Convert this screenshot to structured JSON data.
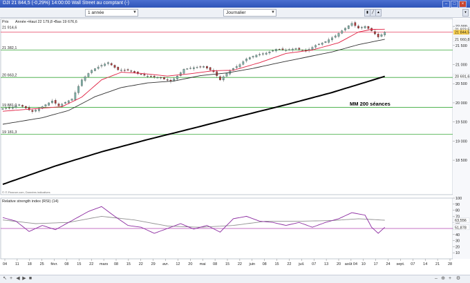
{
  "window": {
    "title": "DJI 21 844,5 (-0,29%) 14:00:00 Wall Street au comptant (-)",
    "logo_icon": "dji-instrument-icon"
  },
  "toolbar": {
    "period": "1 année",
    "interval": "Journalier"
  },
  "colors": {
    "candle_up": "#7fb2a8",
    "candle_down": "#b03a3a",
    "ma20": "#e01e40",
    "ma50": "#303030",
    "ma200": "#000000",
    "levels": "#38a838",
    "current": "#e01e40",
    "rsi": "#8b2aa0",
    "rsi_signal": "#909090",
    "rsi_mid": "#b040b0"
  },
  "chart_data": [
    {
      "type": "candlestick",
      "panel": "price",
      "title": "Prix",
      "info": "Année •Haut 22 179,8 •Bas 19 676,6",
      "source": "© IT-Finance.com, Données indicatives",
      "annotation": "MM 200 séances",
      "ylim": [
        17600,
        22200
      ],
      "y_ticks": [
        "22 000",
        "21 500",
        "21 000",
        "20 500",
        "20 000",
        "19 500",
        "19 000",
        "18 500"
      ],
      "y_tick_values": [
        22000,
        21500,
        21000,
        20500,
        20000,
        19500,
        19000,
        18500
      ],
      "horizontal_levels": [
        {
          "label": "21 382,1",
          "value": 21382.1
        },
        {
          "label": "20 663,2",
          "value": 20663.2
        },
        {
          "label": "19 881,0",
          "value": 19881
        },
        {
          "label": "19 181,3",
          "value": 19181.3
        }
      ],
      "value_tags": [
        {
          "label": "21 923,5",
          "value": 21923.5
        },
        {
          "label": "21 844,5",
          "value": 21844.5
        },
        {
          "label": "21 660,8",
          "value": 21660.8
        },
        {
          "label": "20 691,6",
          "value": 20691.6
        }
      ],
      "left_labels": [
        {
          "label": "21 914,6",
          "value": 21914.6
        }
      ],
      "current_price": {
        "label": "21 844,5",
        "value": 21844.5
      },
      "x_ticks": [
        "04",
        "11",
        "18",
        "25",
        "févr.",
        "08",
        "15",
        "22",
        "mars",
        "08",
        "15",
        "22",
        "29",
        "avr.",
        "12",
        "20",
        "mai",
        "08",
        "15",
        "22",
        "juin",
        "08",
        "15",
        "22",
        "juil.",
        "07",
        "13",
        "20",
        "août 04",
        "10",
        "17",
        "24",
        "sept.",
        "07",
        "14",
        "21",
        "28"
      ],
      "anchors": [
        {
          "d": 0,
          "c": 19850
        },
        {
          "d": 3,
          "c": 19880
        },
        {
          "d": 5,
          "c": 19950
        },
        {
          "d": 9,
          "c": 19770
        },
        {
          "d": 12,
          "c": 19900
        },
        {
          "d": 15,
          "c": 20050
        },
        {
          "d": 17,
          "c": 19920
        },
        {
          "d": 21,
          "c": 20100
        },
        {
          "d": 24,
          "c": 20600
        },
        {
          "d": 27,
          "c": 20850
        },
        {
          "d": 30,
          "c": 20980
        },
        {
          "d": 32,
          "c": 21050
        },
        {
          "d": 35,
          "c": 20860
        },
        {
          "d": 38,
          "c": 20850
        },
        {
          "d": 41,
          "c": 20760
        },
        {
          "d": 44,
          "c": 20700
        },
        {
          "d": 48,
          "c": 20650
        },
        {
          "d": 51,
          "c": 20560
        },
        {
          "d": 53,
          "c": 20700
        },
        {
          "d": 55,
          "c": 20880
        },
        {
          "d": 58,
          "c": 20920
        },
        {
          "d": 61,
          "c": 20950
        },
        {
          "d": 64,
          "c": 20810
        },
        {
          "d": 66,
          "c": 20600
        },
        {
          "d": 69,
          "c": 20850
        },
        {
          "d": 72,
          "c": 21000
        },
        {
          "d": 74,
          "c": 21150
        },
        {
          "d": 77,
          "c": 21250
        },
        {
          "d": 80,
          "c": 21300
        },
        {
          "d": 83,
          "c": 21400
        },
        {
          "d": 86,
          "c": 21380
        },
        {
          "d": 89,
          "c": 21420
        },
        {
          "d": 92,
          "c": 21350
        },
        {
          "d": 95,
          "c": 21500
        },
        {
          "d": 98,
          "c": 21600
        },
        {
          "d": 101,
          "c": 21750
        },
        {
          "d": 104,
          "c": 21950
        },
        {
          "d": 106,
          "c": 22080
        },
        {
          "d": 108,
          "c": 21950
        },
        {
          "d": 110,
          "c": 22000
        },
        {
          "d": 112,
          "c": 21880
        },
        {
          "d": 114,
          "c": 21720
        },
        {
          "d": 116,
          "c": 21844.5
        }
      ],
      "ma20_anchors": [
        {
          "d": 0,
          "v": 19780
        },
        {
          "d": 18,
          "v": 19900
        },
        {
          "d": 24,
          "v": 20150
        },
        {
          "d": 30,
          "v": 20600
        },
        {
          "d": 36,
          "v": 20800
        },
        {
          "d": 42,
          "v": 20770
        },
        {
          "d": 50,
          "v": 20700
        },
        {
          "d": 57,
          "v": 20760
        },
        {
          "d": 64,
          "v": 20840
        },
        {
          "d": 70,
          "v": 20850
        },
        {
          "d": 78,
          "v": 21050
        },
        {
          "d": 86,
          "v": 21290
        },
        {
          "d": 94,
          "v": 21380
        },
        {
          "d": 102,
          "v": 21570
        },
        {
          "d": 108,
          "v": 21850
        },
        {
          "d": 112,
          "v": 21920
        },
        {
          "d": 116,
          "v": 21923.5
        }
      ],
      "ma50_anchors": [
        {
          "d": 0,
          "v": 19440
        },
        {
          "d": 12,
          "v": 19610
        },
        {
          "d": 20,
          "v": 19800
        },
        {
          "d": 28,
          "v": 20160
        },
        {
          "d": 36,
          "v": 20400
        },
        {
          "d": 44,
          "v": 20520
        },
        {
          "d": 52,
          "v": 20570
        },
        {
          "d": 60,
          "v": 20710
        },
        {
          "d": 68,
          "v": 20780
        },
        {
          "d": 76,
          "v": 20900
        },
        {
          "d": 84,
          "v": 21050
        },
        {
          "d": 92,
          "v": 21190
        },
        {
          "d": 100,
          "v": 21330
        },
        {
          "d": 108,
          "v": 21520
        },
        {
          "d": 116,
          "v": 21660.8
        }
      ],
      "ma200_anchors": [
        {
          "d": 0,
          "v": 17870
        },
        {
          "d": 16,
          "v": 18350
        },
        {
          "d": 30,
          "v": 18720
        },
        {
          "d": 44,
          "v": 19040
        },
        {
          "d": 58,
          "v": 19340
        },
        {
          "d": 72,
          "v": 19650
        },
        {
          "d": 86,
          "v": 19950
        },
        {
          "d": 100,
          "v": 20270
        },
        {
          "d": 116,
          "v": 20691.6
        }
      ]
    },
    {
      "type": "line",
      "panel": "rsi",
      "title": "Relative strength index (RSI) (14)",
      "ylim": [
        0,
        100
      ],
      "y_ticks": [
        "100",
        "90",
        "80",
        "70",
        "60",
        "50",
        "40",
        "30",
        "20",
        "10"
      ],
      "y_tick_values": [
        100,
        90,
        80,
        70,
        60,
        50,
        40,
        30,
        20,
        10
      ],
      "value_tags": [
        {
          "label": "63,556",
          "value": 63.556
        },
        {
          "label": "51,878",
          "value": 51.878
        }
      ],
      "midline": 50,
      "rsi_anchors": [
        {
          "d": 0,
          "v": 68
        },
        {
          "d": 4,
          "v": 62
        },
        {
          "d": 8,
          "v": 45
        },
        {
          "d": 12,
          "v": 55
        },
        {
          "d": 16,
          "v": 48
        },
        {
          "d": 20,
          "v": 60
        },
        {
          "d": 26,
          "v": 78
        },
        {
          "d": 30,
          "v": 86
        },
        {
          "d": 34,
          "v": 70
        },
        {
          "d": 38,
          "v": 55
        },
        {
          "d": 42,
          "v": 52
        },
        {
          "d": 46,
          "v": 42
        },
        {
          "d": 50,
          "v": 50
        },
        {
          "d": 54,
          "v": 58
        },
        {
          "d": 58,
          "v": 49
        },
        {
          "d": 62,
          "v": 55
        },
        {
          "d": 66,
          "v": 44
        },
        {
          "d": 70,
          "v": 66
        },
        {
          "d": 74,
          "v": 70
        },
        {
          "d": 78,
          "v": 62
        },
        {
          "d": 82,
          "v": 60
        },
        {
          "d": 86,
          "v": 55
        },
        {
          "d": 90,
          "v": 60
        },
        {
          "d": 94,
          "v": 52
        },
        {
          "d": 98,
          "v": 60
        },
        {
          "d": 102,
          "v": 66
        },
        {
          "d": 106,
          "v": 76
        },
        {
          "d": 110,
          "v": 72
        },
        {
          "d": 112,
          "v": 52
        },
        {
          "d": 114,
          "v": 42
        },
        {
          "d": 116,
          "v": 51.9
        }
      ],
      "signal_anchors": [
        {
          "d": 0,
          "v": 64
        },
        {
          "d": 10,
          "v": 58
        },
        {
          "d": 20,
          "v": 60
        },
        {
          "d": 30,
          "v": 70
        },
        {
          "d": 40,
          "v": 64
        },
        {
          "d": 50,
          "v": 54
        },
        {
          "d": 60,
          "v": 52
        },
        {
          "d": 70,
          "v": 55
        },
        {
          "d": 80,
          "v": 62
        },
        {
          "d": 90,
          "v": 62
        },
        {
          "d": 100,
          "v": 63
        },
        {
          "d": 108,
          "v": 66
        },
        {
          "d": 116,
          "v": 63.6
        }
      ]
    }
  ]
}
